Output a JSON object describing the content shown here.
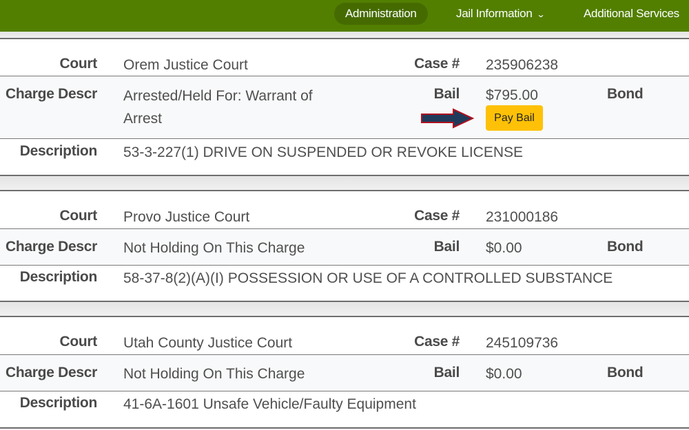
{
  "nav": {
    "items": [
      {
        "label": "Administration",
        "active": true
      },
      {
        "label": "Jail Information",
        "has_dropdown": true
      },
      {
        "label": "Additional Services"
      }
    ]
  },
  "labels": {
    "court": "Court",
    "case": "Case #",
    "charge_descr": "Charge Descr",
    "bail": "Bail",
    "bond": "Bond",
    "description": "Description"
  },
  "charges": [
    {
      "court": "Orem Justice Court",
      "case_number": "235906238",
      "charge_descr": "Arrested/Held For: Warrant of Arrest",
      "bail": "$795.00",
      "pay_bail_label": "Pay Bail",
      "description": "53-3-227(1) DRIVE ON SUSPENDED OR REVOKE LICENSE"
    },
    {
      "court": "Provo Justice Court",
      "case_number": "231000186",
      "charge_descr": "Not Holding On This Charge",
      "bail": "$0.00",
      "description": "58-37-8(2)(A)(I) POSSESSION OR USE OF A CONTROLLED SUBSTANCE"
    },
    {
      "court": "Utah County Justice Court",
      "case_number": "245109736",
      "charge_descr": "Not Holding On This Charge",
      "bail": "$0.00",
      "description": "41-6A-1601 Unsafe Vehicle/Faulty Equipment"
    }
  ],
  "colors": {
    "nav_bg": "#527f00",
    "nav_active": "#456b00",
    "pay_button": "#ffc107",
    "arrow_fill": "#1f3a5a",
    "arrow_border": "#b01020"
  }
}
